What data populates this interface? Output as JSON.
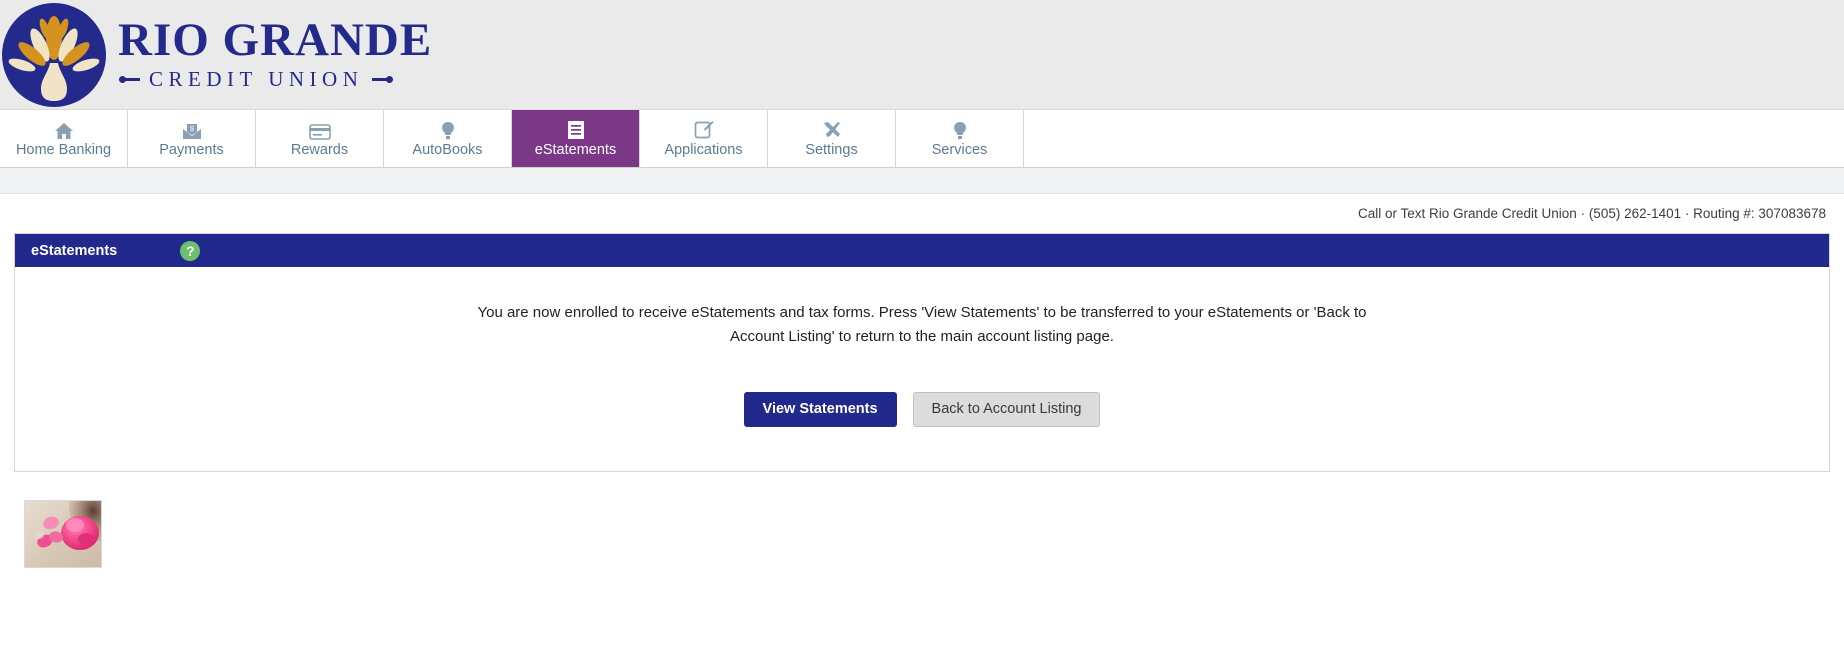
{
  "brand": {
    "name_line1": "RIO GRANDE",
    "name_line2": "CREDIT UNION",
    "navy": "#212a8c",
    "gold": "#d4921f",
    "purple": "#7b3887"
  },
  "nav": {
    "items": [
      {
        "label": "Home Banking",
        "icon": "home-icon",
        "active": false
      },
      {
        "label": "Payments",
        "icon": "mail-money-icon",
        "active": false
      },
      {
        "label": "Rewards",
        "icon": "credit-card-icon",
        "active": false
      },
      {
        "label": "AutoBooks",
        "icon": "lightbulb-icon",
        "active": false
      },
      {
        "label": "eStatements",
        "icon": "document-icon",
        "active": true
      },
      {
        "label": "Applications",
        "icon": "form-pencil-icon",
        "active": false
      },
      {
        "label": "Settings",
        "icon": "tools-icon",
        "active": false
      },
      {
        "label": "Services",
        "icon": "lightbulb-icon",
        "active": false
      }
    ]
  },
  "contact": {
    "text": "Call or Text Rio Grande Credit Union · (505) 262-1401 · Routing #: 307083678"
  },
  "card": {
    "title": "eStatements",
    "help_label": "?",
    "message": "You are now enrolled to receive eStatements and tax forms. Press 'View Statements' to be transferred to your eStatements or 'Back to Account Listing' to return to the main account listing page.",
    "primary_button": "View Statements",
    "secondary_button": "Back to Account Listing"
  },
  "footer": {
    "thumbnail_alt": "pink flower petals photo"
  }
}
